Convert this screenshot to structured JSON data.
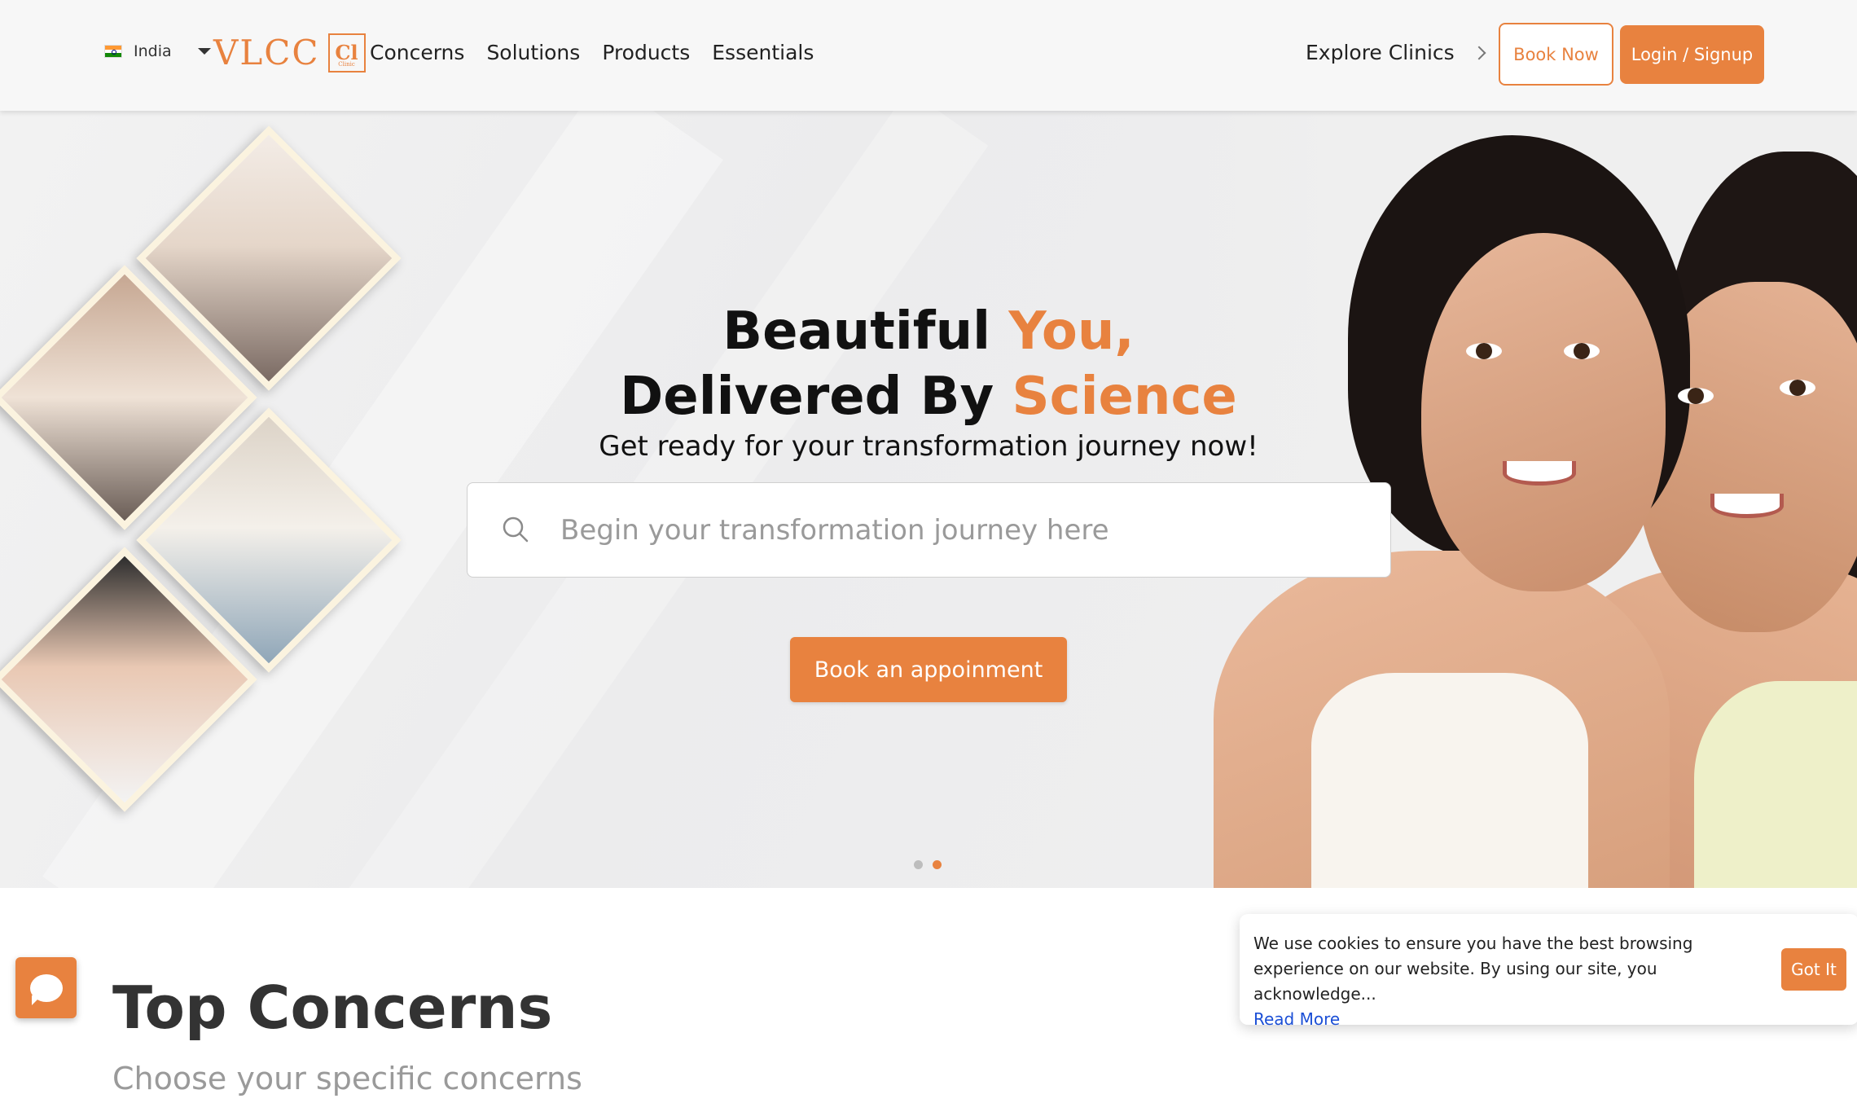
{
  "nav": {
    "country": "India",
    "logo_text": "VLCC",
    "logo_badge": "Cl",
    "logo_badge_sub": "Clinic",
    "menu": [
      "Concerns",
      "Solutions",
      "Products",
      "Essentials"
    ],
    "explore": "Explore Clinics",
    "book_now": "Book Now",
    "login": "Login / Signup"
  },
  "hero": {
    "title_line1_a": "Beautiful ",
    "title_line1_b": "You,",
    "title_line2_a": "Delivered By ",
    "title_line2_b": "Science",
    "subtitle": "Get ready for your transformation journey now!",
    "search_placeholder": "Begin your transformation journey here",
    "cta": "Book an appoinment",
    "carousel": {
      "slides": 2,
      "active": 2
    }
  },
  "section": {
    "title": "Top Concerns",
    "subtitle": "Choose your specific concerns"
  },
  "cookie": {
    "text": "We use cookies to ensure you have the best browsing experience on our website. By using our site, you acknowledge...",
    "link": "Read More",
    "button": "Got It"
  },
  "colors": {
    "accent": "#e8823f",
    "link": "#1b4fd6"
  },
  "icons": [
    "india-flag-icon",
    "caret-down-icon",
    "chevron-right-icon",
    "search-icon",
    "chat-icon"
  ]
}
